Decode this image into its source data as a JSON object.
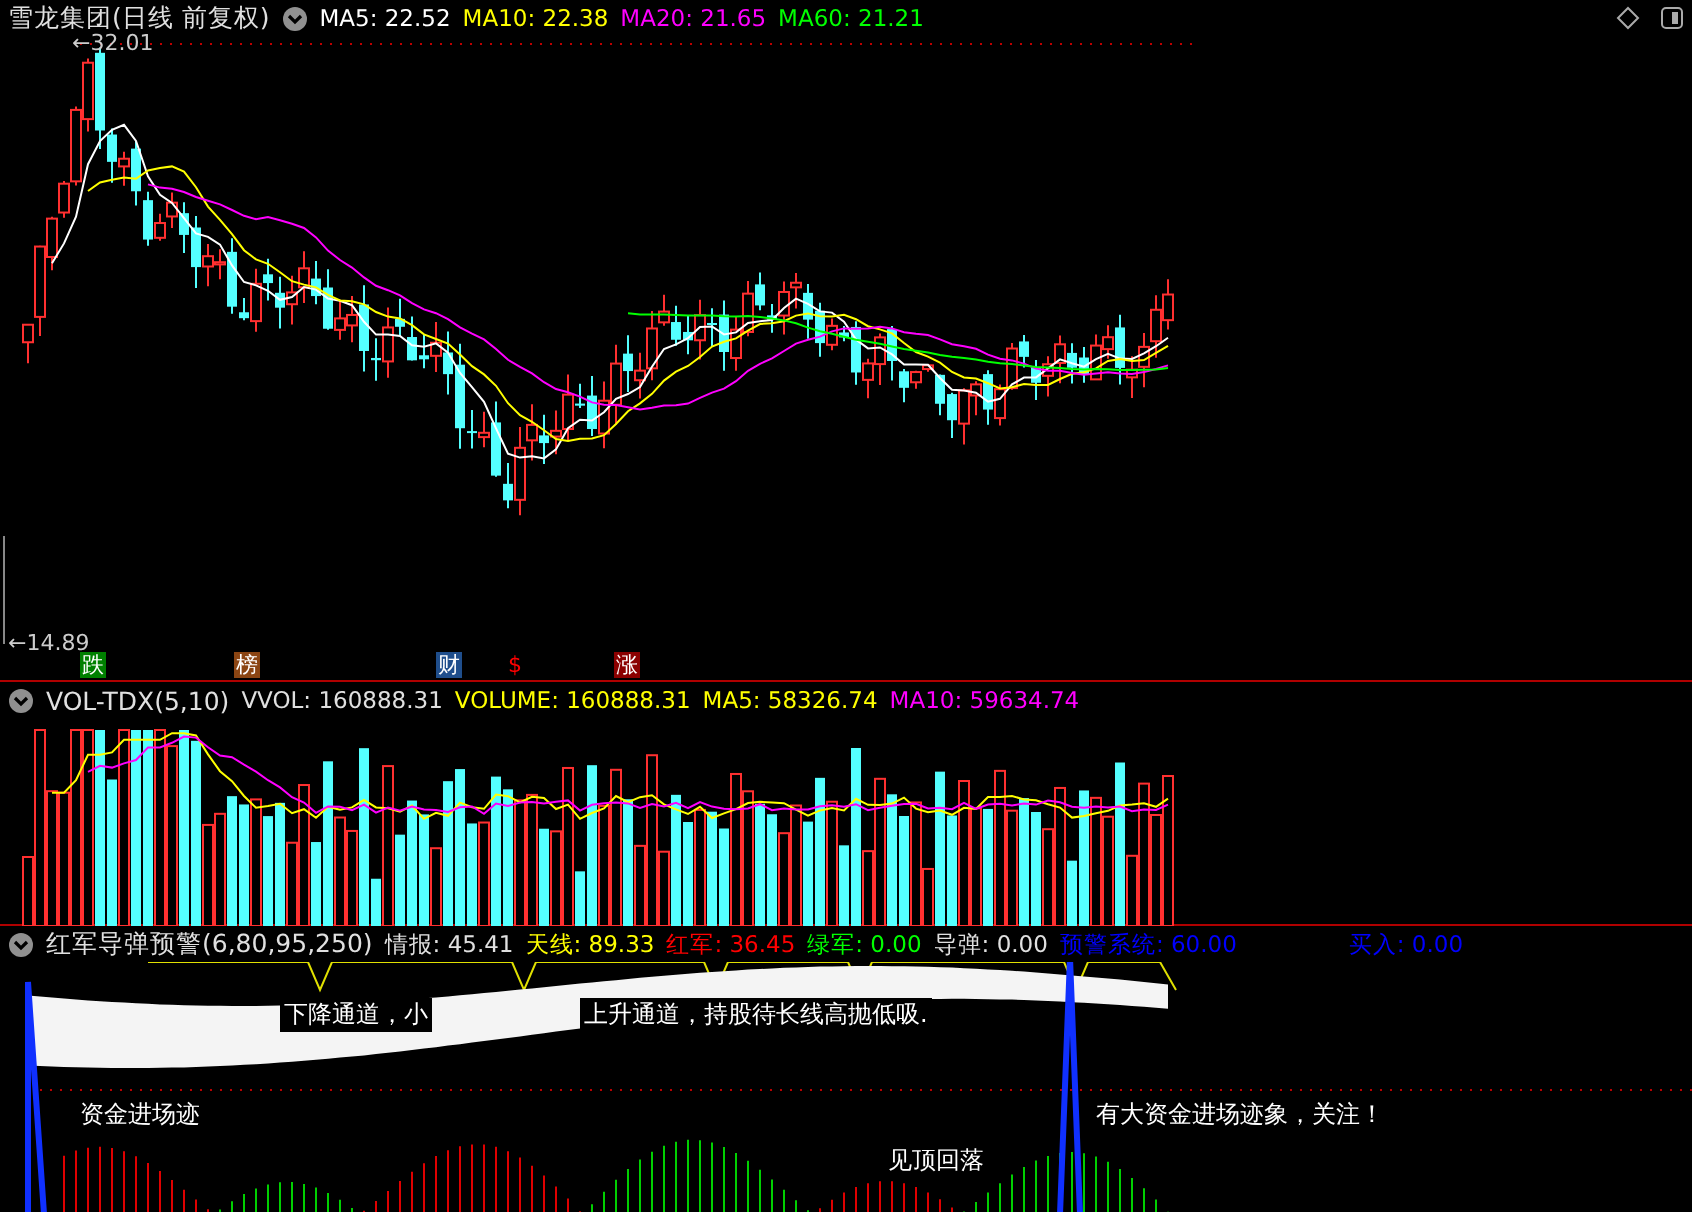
{
  "main": {
    "title": "雪龙集团(日线 前复权)",
    "indicators": [
      {
        "label": "MA5: 22.52",
        "color": "#ffffff"
      },
      {
        "label": "MA10: 22.38",
        "color": "#ffff00"
      },
      {
        "label": "MA20: 21.65",
        "color": "#ff00ff"
      },
      {
        "label": "MA60: 21.21",
        "color": "#00ff00"
      }
    ],
    "high_label": "←32.01",
    "low_label": "←14.89",
    "markers": [
      {
        "text": "跌",
        "kind": "badge",
        "color": "#008000"
      },
      {
        "text": "榜",
        "kind": "badge",
        "color": "#8b4513"
      },
      {
        "text": "财",
        "kind": "badge",
        "color": "#1f4e8c"
      },
      {
        "text": "$",
        "kind": "plain",
        "color": "#ff0000"
      },
      {
        "text": "涨",
        "kind": "badge",
        "color": "#8b0000"
      }
    ]
  },
  "volume": {
    "title": "VOL-TDX(5,10)",
    "indicators": [
      {
        "label": "VVOL: 160888.31",
        "color": "#e0e0e0"
      },
      {
        "label": "VOLUME: 160888.31",
        "color": "#ffff00"
      },
      {
        "label": "MA5: 58326.74",
        "color": "#ffff00"
      },
      {
        "label": "MA10: 59634.74",
        "color": "#ff00ff"
      }
    ]
  },
  "indicator": {
    "title": "红军导弹预警(6,80,95,250)",
    "values": [
      {
        "label": "情报: 45.41",
        "color": "#e0e0e0"
      },
      {
        "label": "天线: 89.33",
        "color": "#ffff00"
      },
      {
        "label": "红军: 36.45",
        "color": "#ff0000"
      },
      {
        "label": "绿军: 0.00",
        "color": "#00ff00"
      },
      {
        "label": "导弹: 0.00",
        "color": "#e0e0e0"
      },
      {
        "label": "预警系统: 60.00",
        "color": "#0000ff"
      },
      {
        "label": "买入: 0.00",
        "color": "#0000ff"
      }
    ],
    "notes": [
      "下降通道，小",
      "上升通道，持股待长线高抛低吸.",
      "资金进场迹",
      "有大资金进场迹象，关注！",
      "见顶回落"
    ]
  }
}
